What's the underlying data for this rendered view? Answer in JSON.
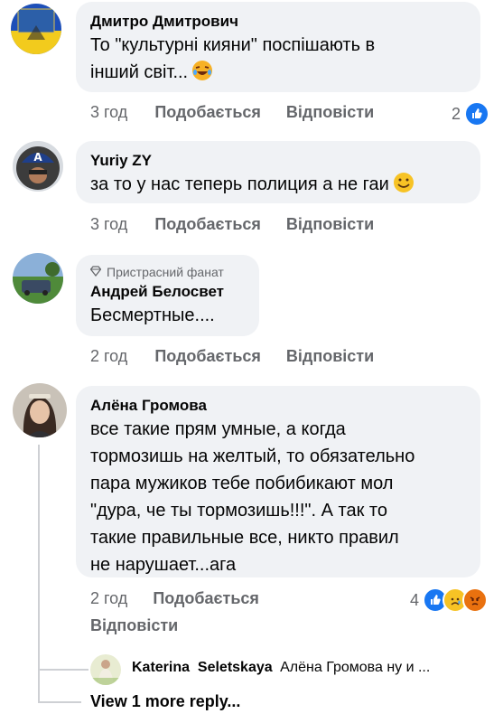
{
  "comments": [
    {
      "author": "Дмитро Дмитрович",
      "lines": [
        "То \"культурні кияни\" поспішають в",
        "інший світ..."
      ],
      "emoji": "laughing-tears",
      "time": "3 год",
      "like_label": "Подобається",
      "reply_label": "Відповісти",
      "reaction_count": "2",
      "reactions": [
        "like"
      ]
    },
    {
      "author": "Yuriy ZY",
      "lines": [
        "за то у нас теперь полиция а не гаи"
      ],
      "emoji": "smile",
      "time": "3 год",
      "like_label": "Подобається",
      "reply_label": "Відповісти"
    },
    {
      "badge": "Пристрасний фанат",
      "author": "Андрей Белосвет",
      "lines": [
        "Бесмертные...."
      ],
      "time": "2 год",
      "like_label": "Подобається",
      "reply_label": "Відповісти"
    },
    {
      "author": "Алёна Громова",
      "lines": [
        "все такие прям умные, а когда",
        "тормозишь на желтый, то обязательно",
        "пара мужиков тебе побибикают мол",
        "\"дура, че ты тормозишь!!!\". А так то",
        "такие правильные все, никто правил",
        "не нарушает...ага"
      ],
      "time": "2 год",
      "like_label": "Подобається",
      "reply_label": "Відповісти",
      "reaction_count": "4",
      "reactions": [
        "like",
        "sad",
        "angry"
      ]
    }
  ],
  "reply": {
    "author": "Katerina  Seletskaya",
    "preview": "Алёна Громова ну и ..."
  },
  "view_more": "View 1 more reply...",
  "colors": {
    "bubble": "#f0f2f5",
    "meta": "#65676b",
    "like_blue": "#1877f2",
    "angry_red": "#e9710f"
  }
}
